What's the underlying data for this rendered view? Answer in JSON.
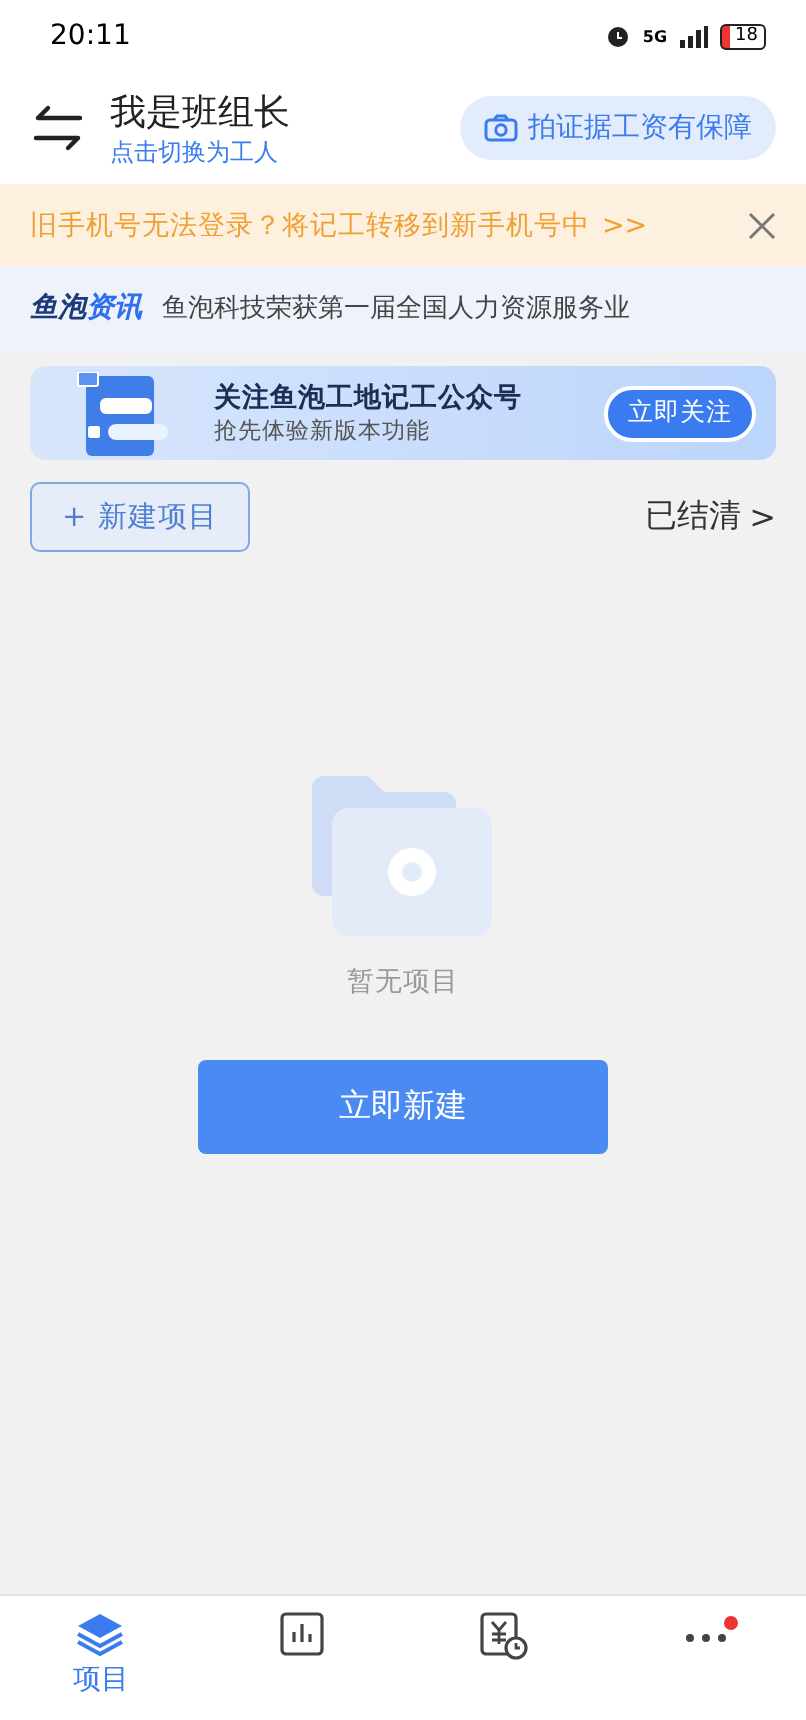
{
  "status_bar": {
    "time": "20:11",
    "network": "5G",
    "battery": "18"
  },
  "header": {
    "title": "我是班组长",
    "subtitle": "点击切换为工人",
    "action": "拍证据工资有保障"
  },
  "notice": {
    "text": "旧手机号无法登录？将记工转移到新手机号中",
    "link": ">>"
  },
  "news": {
    "brand_dark": "鱼泡",
    "brand_accent": "资讯",
    "headline": "鱼泡科技荣获第一届全国人力资源服务业"
  },
  "banner": {
    "title": "关注鱼泡工地记工公众号",
    "subtitle": "抢先体验新版本功能",
    "button": "立即关注"
  },
  "toolbar": {
    "new_project": "新建项目",
    "plus": "+",
    "settled": "已结清",
    "chevron": ">"
  },
  "empty": {
    "text": "暂无项目",
    "button": "立即新建"
  },
  "tabs": [
    {
      "label": "项目",
      "kind": "layers",
      "selected": true
    },
    {
      "kind": "chart",
      "selected": false
    },
    {
      "kind": "salary",
      "selected": false
    },
    {
      "kind": "more",
      "selected": false,
      "badge": true
    }
  ]
}
